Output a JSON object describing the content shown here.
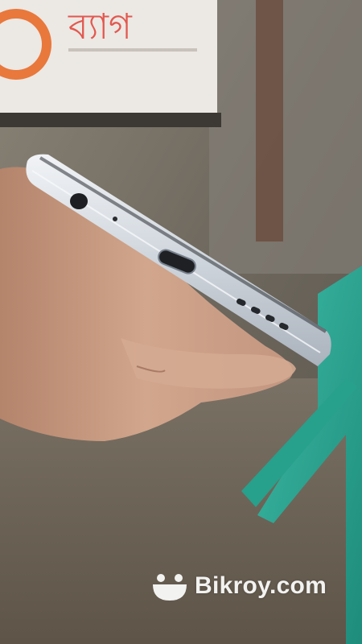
{
  "photo": {
    "subject": "smartphone bottom edge held in hand",
    "signboard_text": "ব্যাগ",
    "phone_ports": [
      "headphone-jack",
      "microphone-hole",
      "usb-c-port",
      "speaker-grille"
    ],
    "colors": {
      "wall": "#7a7469",
      "signboard": "#ece8e4",
      "signboard_lettering": "#e2584f",
      "phone_frame": "#d9dee3",
      "skin": "#c79a82",
      "stool": "#2aa38f"
    }
  },
  "watermark": {
    "brand": "Bikroy.com"
  }
}
